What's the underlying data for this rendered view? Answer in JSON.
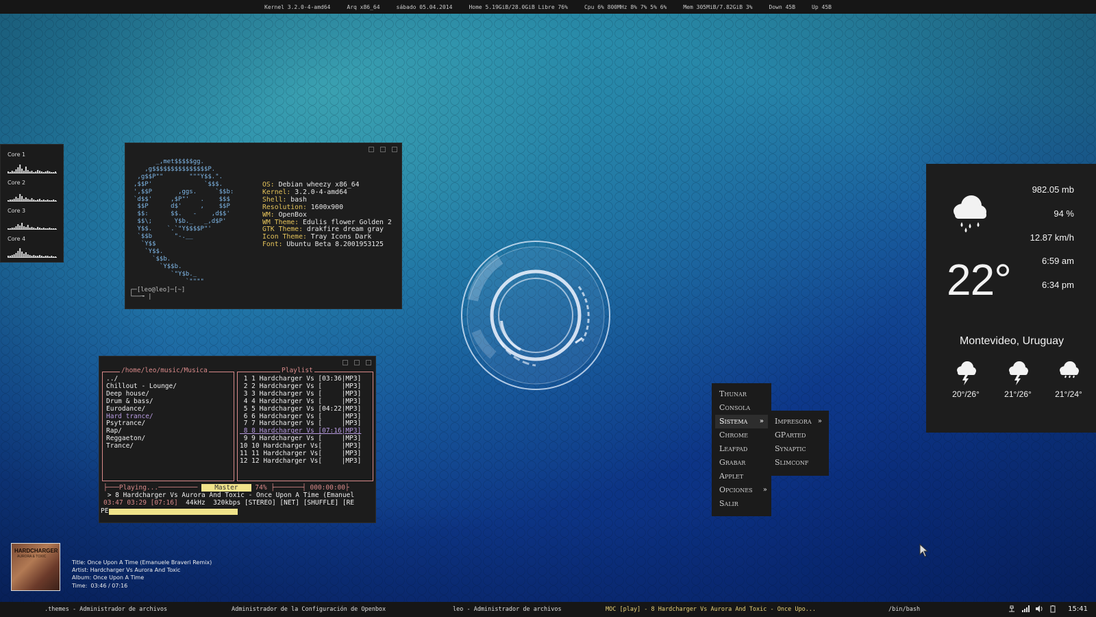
{
  "topbar": {
    "kernel": "Kernel 3.2.0-4-amd64",
    "arch": "Arq x86_64",
    "date": "sábado 05.04.2014",
    "home": "Home 5.19GiB/28.0GiB Libre 76%",
    "cpu": "Cpu 6% 800MHz 8% 7% 5% 6%",
    "mem": "Mem 305MiB/7.82GiB 3%",
    "down": "Down 45B",
    "up": "Up 45B"
  },
  "cores": {
    "labels": [
      "Core 1",
      "Core 2",
      "Core 3",
      "Core 4"
    ],
    "activity": [
      [
        2,
        1,
        3,
        2,
        5,
        8,
        12,
        6,
        3,
        9,
        4,
        2,
        3,
        1,
        2,
        4,
        3,
        2,
        1,
        2,
        3,
        2,
        1,
        1,
        2
      ],
      [
        1,
        2,
        2,
        3,
        6,
        4,
        10,
        7,
        3,
        5,
        3,
        2,
        4,
        2,
        1,
        2,
        3,
        1,
        2,
        1,
        2,
        1,
        1,
        2,
        1
      ],
      [
        1,
        1,
        2,
        2,
        4,
        7,
        5,
        9,
        4,
        3,
        6,
        2,
        3,
        2,
        1,
        3,
        2,
        1,
        2,
        1,
        1,
        2,
        1,
        1,
        1
      ],
      [
        2,
        2,
        3,
        4,
        6,
        9,
        13,
        8,
        5,
        7,
        4,
        3,
        2,
        3,
        2,
        2,
        3,
        2,
        1,
        2,
        2,
        1,
        2,
        1,
        1
      ]
    ]
  },
  "terminal": {
    "ascii_logo": "      _,met$$$$$gg.\n   ,g$$$$$$$$$$$$$$$P.\n ,g$$P\"\"       \"\"\"Y$$.\".\n,$$P'              `$$$.\n',$$P       ,ggs.     `$$b:\n`d$$'     ,$P\"'   .    $$$\n $$P      d$'     ,    $$P\n $$:      $$.   -    ,d$$'\n $$\\;      Y$b._   _,d$P'\n Y$$.    `.`\"Y$$$$P\"'\n `$$b      \"-.__\n  `Y$$\n   `Y$$.\n     `$$b.\n       `Y$$b.\n          `\"Y$b._\n              `\"\"\"\"",
    "info": [
      {
        "key": "OS:",
        "value": "Debian wheezy x86_64"
      },
      {
        "key": "Kernel:",
        "value": "3.2.0-4-amd64"
      },
      {
        "key": "Shell:",
        "value": "bash"
      },
      {
        "key": "Resolution:",
        "value": "1600x900"
      },
      {
        "key": "WM:",
        "value": "OpenBox"
      },
      {
        "key": "WM Theme:",
        "value": "Edulis flower Golden 2"
      },
      {
        "key": "GTK Theme:",
        "value": "drakfire dream gray"
      },
      {
        "key": "Icon Theme:",
        "value": "Tray Icons Dark"
      },
      {
        "key": "Font:",
        "value": "Ubuntu Beta 8.2001953125"
      }
    ],
    "prompt_line1": "┌─[leo@leo]─[~]",
    "prompt_line2": "└──╼ |"
  },
  "moc": {
    "dir_title": "/home/leo/music/Musica",
    "dirs": [
      "../",
      "Chillout - Lounge/",
      "Deep house/",
      "Drum & bass/",
      "Eurodance/",
      "Hard trance/",
      "Psytrance/",
      "Rap/",
      "Reggaeton/",
      "Trance/"
    ],
    "selected_dir": "Hard trance/",
    "playlist_title": "Playlist",
    "playlist": [
      " 1 1 Hardcharger Vs [03:36|MP3]",
      " 2 2 Hardcharger Vs [     |MP3]",
      " 3 3 Hardcharger Vs [     |MP3]",
      " 4 4 Hardcharger Vs [     |MP3]",
      " 5 5 Hardcharger Vs [04:22|MP3]",
      " 6 6 Hardcharger Vs [     |MP3]",
      " 7 7 Hardcharger Vs [     |MP3]",
      " 8 8 Hardcharger Vs [07:16|MP3]",
      " 9 9 Hardcharger Vs [     |MP3]",
      "10 10 Hardcharger Vs[     |MP3]",
      "11 11 Hardcharger Vs[     |MP3]",
      "12 12 Hardcharger Vs[     |MP3]"
    ],
    "current_index": 7,
    "playing_label": "Playing...",
    "master_label": "Master",
    "volume": "74%",
    "elapsed_box": "000:00:00",
    "now_playing": " > 8 Hardcharger Vs Aurora And Toxic - Once Upon A Time (Emanuel",
    "times": "03:47 03:29 [07:16]",
    "format_info": "44kHz  320kbps [STEREO] [NET] [SHUFFLE] [RE",
    "progress_fraction": 0.49,
    "pe_label": "PE"
  },
  "weather": {
    "pressure": "982.05 mb",
    "humidity": "94 %",
    "wind": "12.87 km/h",
    "sunrise": "6:59 am",
    "sunset": "6:34 pm",
    "temperature": "22°",
    "location": "Montevideo, Uruguay",
    "forecast": [
      {
        "range": "20°/26°",
        "icon": "thunderstorm-icon"
      },
      {
        "range": "21°/26°",
        "icon": "thunderstorm-icon"
      },
      {
        "range": "21°/24°",
        "icon": "thunderstorm-icon"
      }
    ],
    "current_icon": "rain-cloud-icon"
  },
  "menu": {
    "items": [
      "Thunar",
      "Consola",
      "Sistema",
      "Chrome",
      "Leafpad",
      "Grabar",
      "Applet",
      "Opciones",
      "Salir"
    ],
    "submenu": [
      "Impresora",
      "GParted",
      "Synaptic",
      "Slimconf"
    ]
  },
  "track_info": {
    "title": "Title: Once Upon A Time (Emanuele Braveri Remix)",
    "artist": "Artist: Hardcharger Vs Aurora And Toxic",
    "album": "Album: Once Upon A Time",
    "time": "Time:  03:46 / 07:16",
    "cover_text": "HARDCHARGER",
    "cover_sub": "AURORA & TOXIC"
  },
  "taskbar": {
    "tasks": [
      ".themes - Administrador de archivos",
      "Administrador de la Configuración de Openbox",
      "leo - Administrador de archivos",
      "MOC [play] - 8 Hardcharger Vs Aurora And Toxic - Once Upo...",
      "/bin/bash"
    ],
    "active_task_index": 3,
    "clock": "15:41",
    "tray_icons": [
      "network-icon",
      "signal-icon",
      "volume-icon",
      "battery-icon"
    ]
  },
  "colors": {
    "accent_yellow": "#f0e38a",
    "moc_border": "#d98a8a",
    "info_key": "#e5c35a",
    "ascii": "#7fb6e6",
    "selected_purple": "#b79be0"
  }
}
